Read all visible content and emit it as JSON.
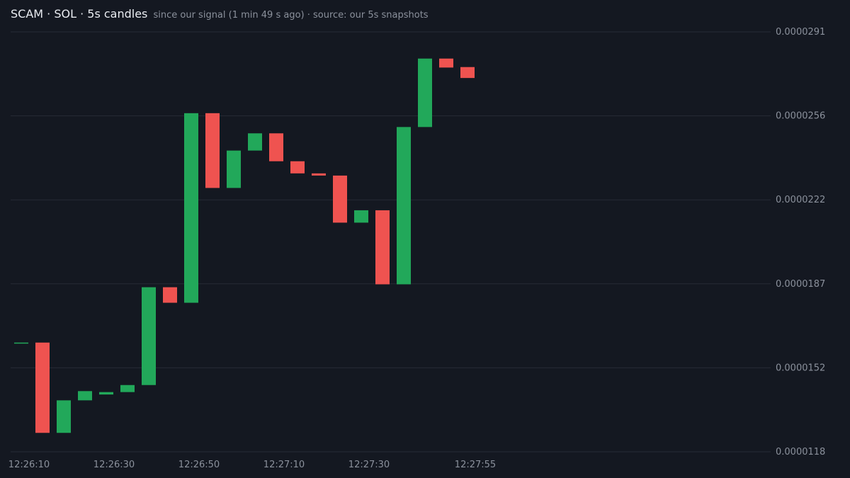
{
  "header": {
    "title": "SCAM · SOL · 5s candles",
    "subtitle": "since our signal (1 min 49 s ago) · source: our 5s snapshots"
  },
  "colors": {
    "background": "#141821",
    "grid": "#262b36",
    "up": "#22a85a",
    "down": "#ef5350",
    "text": "#8b919c",
    "title": "#e9ecf1"
  },
  "chart_data": {
    "type": "candlestick",
    "title": "SCAM · SOL · 5s candles",
    "subtitle": "since our signal (1 min 49 s ago) · source: our 5s snapshots",
    "y_ticks": [
      "0.0000291",
      "0.0000256",
      "0.0000222",
      "0.0000187",
      "0.0000152",
      "0.0000118"
    ],
    "ylim": [
      1.18e-05,
      2.91e-05
    ],
    "x_ticks": [
      {
        "label": "12:26:10",
        "index": 0
      },
      {
        "label": "12:26:30",
        "index": 4
      },
      {
        "label": "12:26:50",
        "index": 8
      },
      {
        "label": "12:27:10",
        "index": 12
      },
      {
        "label": "12:27:30",
        "index": 16
      },
      {
        "label": "12:27:55",
        "index": 21
      }
    ],
    "grid": true,
    "candles": [
      {
        "open": 1.63e-05,
        "close": 1.63e-05
      },
      {
        "open": 1.63e-05,
        "close": 1.258e-05
      },
      {
        "open": 1.258e-05,
        "close": 1.392e-05
      },
      {
        "open": 1.392e-05,
        "close": 1.43e-05
      },
      {
        "open": 1.416e-05,
        "close": 1.426e-05
      },
      {
        "open": 1.426e-05,
        "close": 1.455e-05
      },
      {
        "open": 1.455e-05,
        "close": 1.858e-05
      },
      {
        "open": 1.858e-05,
        "close": 1.794e-05
      },
      {
        "open": 1.794e-05,
        "close": 2.575e-05
      },
      {
        "open": 2.575e-05,
        "close": 2.267e-05
      },
      {
        "open": 2.267e-05,
        "close": 2.421e-05
      },
      {
        "open": 2.421e-05,
        "close": 2.492e-05
      },
      {
        "open": 2.492e-05,
        "close": 2.377e-05
      },
      {
        "open": 2.377e-05,
        "close": 2.327e-05
      },
      {
        "open": 2.327e-05,
        "close": 2.318e-05
      },
      {
        "open": 2.318e-05,
        "close": 2.124e-05
      },
      {
        "open": 2.124e-05,
        "close": 2.175e-05
      },
      {
        "open": 2.175e-05,
        "close": 1.87e-05
      },
      {
        "open": 1.87e-05,
        "close": 2.518e-05
      },
      {
        "open": 2.518e-05,
        "close": 2.8e-05
      },
      {
        "open": 2.8e-05,
        "close": 2.763e-05
      },
      {
        "open": 2.765e-05,
        "close": 2.72e-05
      }
    ]
  }
}
